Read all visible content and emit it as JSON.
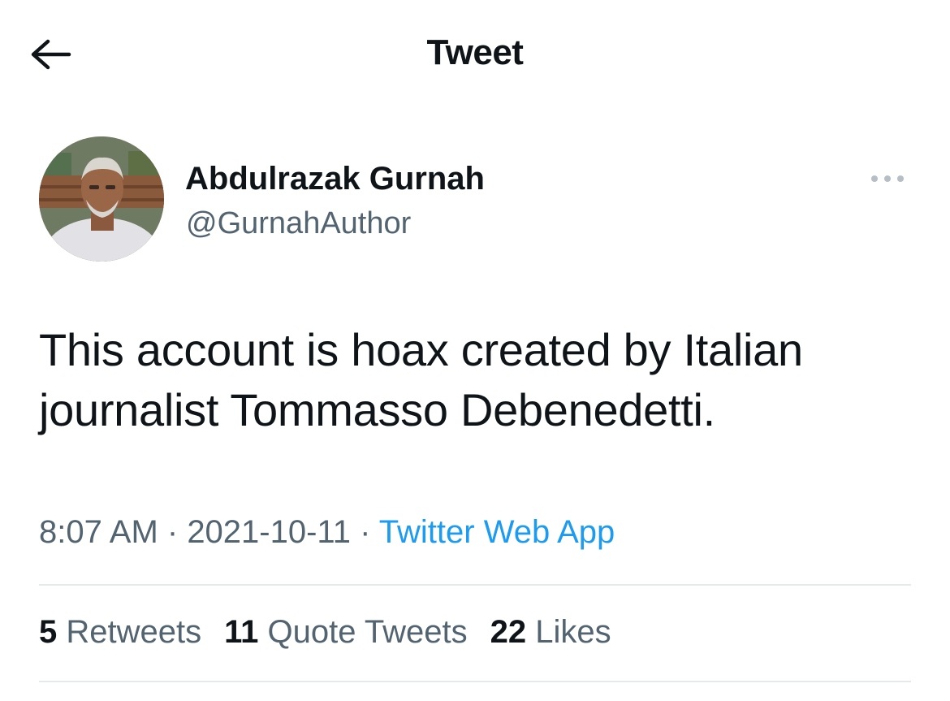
{
  "header": {
    "title": "Tweet",
    "back_icon": "arrow-left-icon"
  },
  "tweet": {
    "author": {
      "display_name": "Abdulrazak Gurnah",
      "handle": "@GurnahAuthor"
    },
    "more_icon": "ellipsis-icon",
    "text": "This account is hoax created by Italian journalist Tommasso Debenedetti.",
    "time": "8:07 AM",
    "separator": " · ",
    "date": "2021-10-11",
    "source": "Twitter Web App"
  },
  "stats": {
    "retweets_count": "5",
    "retweets_label": "Retweets",
    "quotes_count": "11",
    "quotes_label": "Quote Tweets",
    "likes_count": "22",
    "likes_label": "Likes"
  },
  "colors": {
    "text_primary": "#0f1419",
    "text_secondary": "#536471",
    "link": "#1d9bf0",
    "divider": "#e6e9ec"
  }
}
